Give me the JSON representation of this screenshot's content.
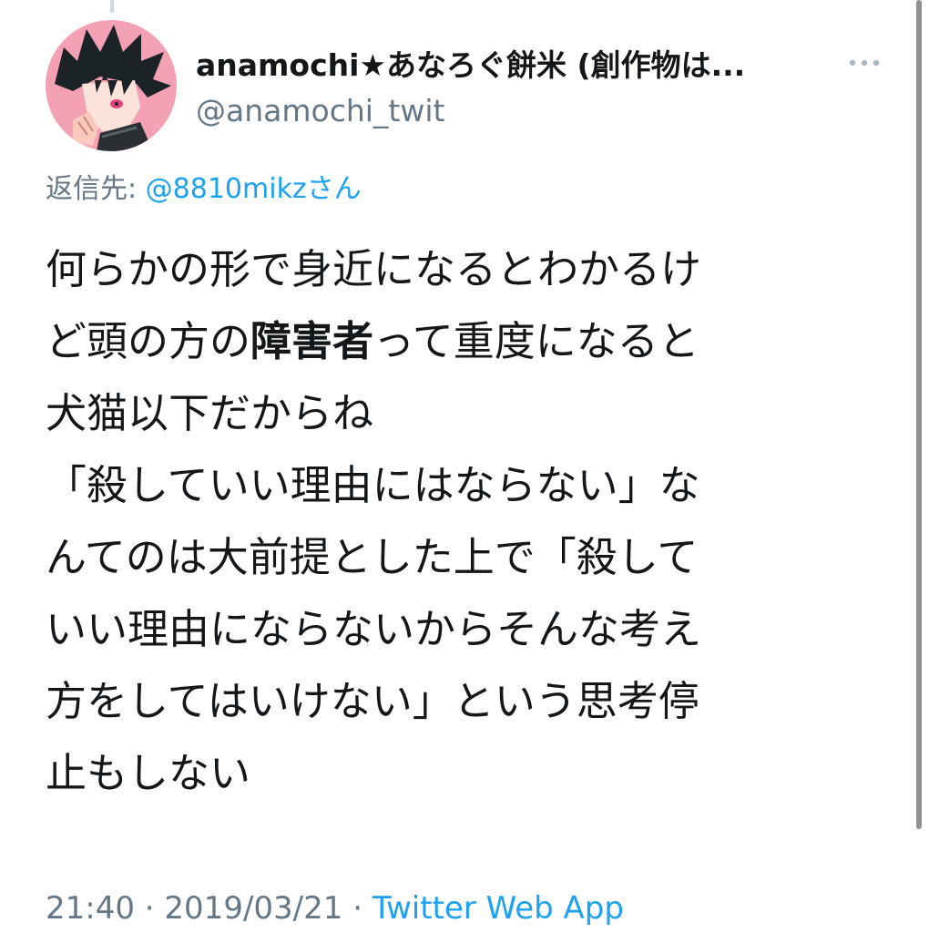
{
  "tweet": {
    "display_name": "anamochi★あなろぐ餅米 (創作物は...",
    "handle": "@anamochi_twit",
    "replying_prefix": "返信先: ",
    "replying_to": "@8810mikz",
    "replying_suffix": "さん",
    "text_lines": [
      "何らかの形で身近になるとわかるけ",
      "ど頭の方の",
      "障害者",
      "って重度になると",
      "犬猫以下だからね",
      "「殺していい理由にはならない」な",
      "んてのは大前提とした上で「殺して",
      "いい理由にならないからそんな考え",
      "方をしてはいけない」という思考停",
      "止もしない"
    ],
    "time": "21:40",
    "separator": " · ",
    "date": "2019/03/21",
    "source": "Twitter Web App"
  },
  "icons": {
    "more": "more-horizontal-icon",
    "avatar": "avatar-anime-character"
  },
  "colors": {
    "text": "#14171a",
    "secondary": "#657786",
    "link": "#1da1f2",
    "avatar_bg": "#f4a0b5"
  }
}
